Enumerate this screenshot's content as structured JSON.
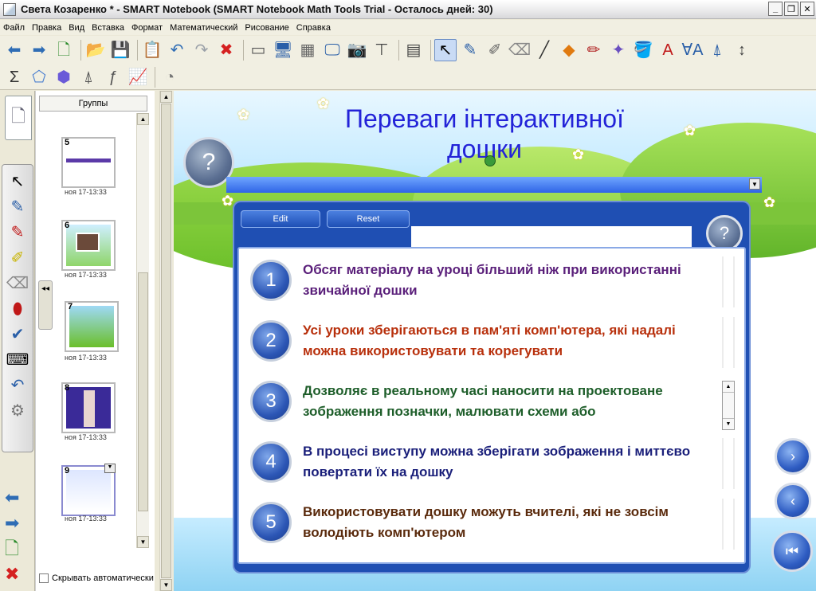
{
  "window": {
    "title": "Света Козаренко * - SMART Notebook (SMART Notebook Math Tools Trial - Осталось дней: 30)",
    "min_label": "_",
    "max_label": "❐",
    "close_label": "✕"
  },
  "menu": [
    "Файл",
    "Правка",
    "Вид",
    "Вставка",
    "Формат",
    "Математический",
    "Рисование",
    "Справка"
  ],
  "toolbar1": [
    {
      "icon": "back-arrow-icon",
      "glyph": "⬅",
      "color": "#2f6db5"
    },
    {
      "icon": "forward-arrow-icon",
      "glyph": "➡",
      "color": "#2f6db5"
    },
    {
      "icon": "add-page-icon",
      "glyph": "🗋",
      "color": "#2a8a2a"
    },
    {
      "icon": "open-folder-icon",
      "glyph": "📂",
      "color": "#d79b12"
    },
    {
      "icon": "save-icon",
      "glyph": "💾",
      "color": "#2a5fa8"
    },
    {
      "icon": "paste-icon",
      "glyph": "📋",
      "color": "#7a6a40"
    },
    {
      "icon": "undo-icon",
      "glyph": "↶",
      "color": "#2f6db5"
    },
    {
      "icon": "redo-icon",
      "glyph": "↷",
      "color": "#9aa0a8"
    },
    {
      "icon": "delete-icon",
      "glyph": "✖",
      "color": "#d52020"
    },
    {
      "icon": "screen-shade-icon",
      "glyph": "▭",
      "color": "#555555"
    },
    {
      "icon": "display-icon",
      "glyph": "🖥",
      "color": "#2a5fa8"
    },
    {
      "icon": "table-grid-icon",
      "glyph": "▦",
      "color": "#666666"
    },
    {
      "icon": "presentation-icon",
      "glyph": "🖵",
      "color": "#2a5fa8"
    },
    {
      "icon": "camera-icon",
      "glyph": "📷",
      "color": "#444444"
    },
    {
      "icon": "document-camera-icon",
      "glyph": "⊤",
      "color": "#444444"
    },
    {
      "icon": "insert-table-icon",
      "glyph": "▤",
      "color": "#444444"
    },
    {
      "icon": "select-arrow-icon",
      "glyph": "↖",
      "color": "#000000",
      "selected": true
    },
    {
      "icon": "pen-icon",
      "glyph": "✎",
      "color": "#2a5fa8"
    },
    {
      "icon": "creative-pen-icon",
      "glyph": "✐",
      "color": "#666666"
    },
    {
      "icon": "eraser-icon",
      "glyph": "⌫",
      "color": "#888888"
    },
    {
      "icon": "line-icon",
      "glyph": "╱",
      "color": "#333333"
    },
    {
      "icon": "shapes-icon",
      "glyph": "◆",
      "color": "#e07a10"
    },
    {
      "icon": "magic-pen-icon",
      "glyph": "✏",
      "color": "#b02020"
    },
    {
      "icon": "magic-wand-icon",
      "glyph": "✦",
      "color": "#6a4fc0"
    },
    {
      "icon": "fill-icon",
      "glyph": "🪣",
      "color": "#2a5fa8"
    },
    {
      "icon": "text-icon",
      "glyph": "A",
      "color": "#c01818"
    },
    {
      "icon": "text-format-icon",
      "glyph": "ⱯA",
      "color": "#2a5fa8"
    },
    {
      "icon": "math-tools-icon",
      "glyph": "⍋",
      "color": "#2a5fa8"
    },
    {
      "icon": "toolbar-move-icon",
      "glyph": "↕",
      "color": "#444444"
    }
  ],
  "toolbar2": [
    {
      "icon": "sigma-icon",
      "glyph": "Σ",
      "color": "#333333"
    },
    {
      "icon": "polygon-icon",
      "glyph": "⬠",
      "color": "#4a7fd0"
    },
    {
      "icon": "3d-shape-icon",
      "glyph": "⬢",
      "color": "#6a5ad8"
    },
    {
      "icon": "compass-icon",
      "glyph": "⍋",
      "color": "#555555"
    },
    {
      "icon": "equation-icon",
      "glyph": "ƒ",
      "color": "#555555"
    },
    {
      "icon": "graph-icon",
      "glyph": "📈",
      "color": "#2a5fa8"
    },
    {
      "icon": "protractor-icon",
      "glyph": "◔",
      "color": "#777777"
    }
  ],
  "sorter": {
    "group_label": "Группы",
    "autohide_label": "Скрывать автоматически",
    "thumbs": [
      {
        "num": "5",
        "date": "ноя 17-13:33"
      },
      {
        "num": "6",
        "date": "ноя 17-13:33"
      },
      {
        "num": "7",
        "date": "ноя 17-13:33"
      },
      {
        "num": "8",
        "date": "ноя 17-13:33"
      },
      {
        "num": "9",
        "date": "ноя 17-13:33"
      }
    ]
  },
  "slide": {
    "title_line1": "Переваги інтерактивної",
    "title_line2": "дошки",
    "help_label": "?",
    "edit_label": "Edit",
    "reset_label": "Reset",
    "items": [
      {
        "num": "1",
        "text": "Обсяг матеріалу на уроці більший ніж при використанні звичайної дошки",
        "color": "#5a1f7a"
      },
      {
        "num": "2",
        "text": "Усі уроки зберігаються в пам'яті комп'ютера, які надалі можна використовувати та корегувати",
        "color": "#b8300c"
      },
      {
        "num": "3",
        "text": "Дозволяє в реальному часі наносити на проектоване зображення позначки, малювати схеми або",
        "color": "#1e5e2a"
      },
      {
        "num": "4",
        "text": "В процесі виступу можна зберігати зображення і миттєво повертати їх на дошку",
        "color": "#1a1f7a"
      },
      {
        "num": "5",
        "text": "Використовувати дошку можуть вчителі, які не зовсім володіють комп'ютером",
        "color": "#5a2a0c"
      }
    ]
  },
  "nav": {
    "next": "›",
    "prev": "‹",
    "first": "⏮"
  }
}
